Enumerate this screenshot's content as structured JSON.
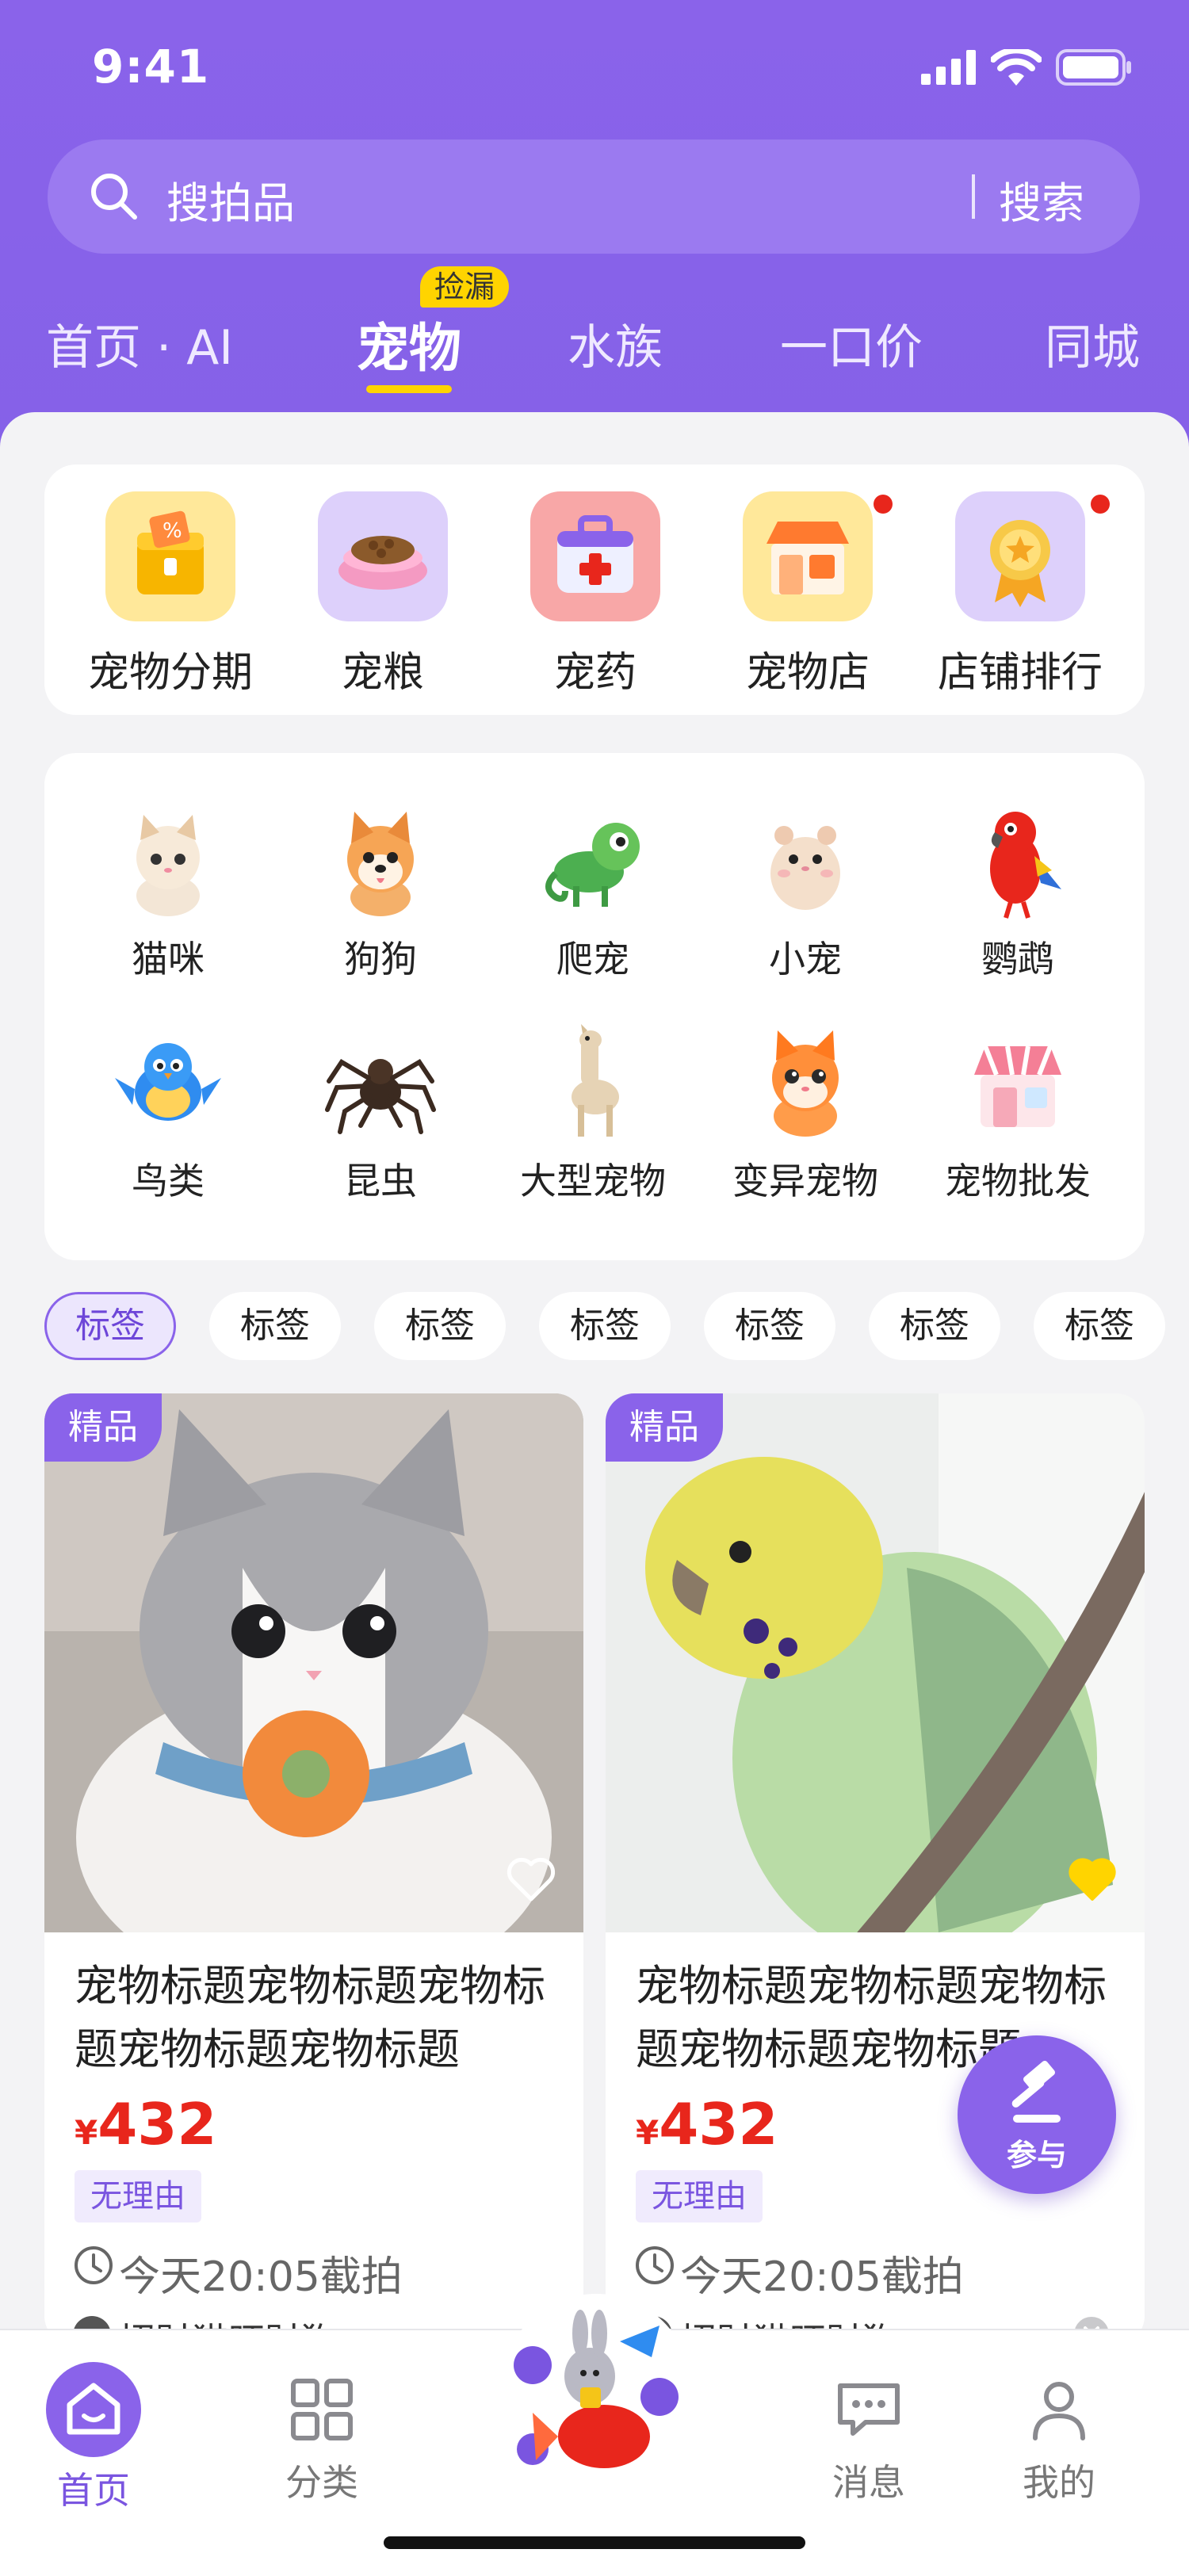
{
  "status": {
    "time": "9:41"
  },
  "search": {
    "placeholder": "搜拍品",
    "button": "搜索"
  },
  "tabs": [
    {
      "label": "首页 · AI"
    },
    {
      "label": "宠物",
      "badge": "捡漏"
    },
    {
      "label": "水族"
    },
    {
      "label": "一口价"
    },
    {
      "label": "同城"
    }
  ],
  "quick_links": [
    {
      "label": "宠物分期",
      "icon": "installment-icon"
    },
    {
      "label": "宠粮",
      "icon": "pet-food-icon"
    },
    {
      "label": "宠药",
      "icon": "medicine-kit-icon"
    },
    {
      "label": "宠物店",
      "icon": "pet-shop-icon"
    },
    {
      "label": "店铺排行",
      "icon": "ranking-medal-icon"
    }
  ],
  "categories": [
    {
      "label": "猫咪"
    },
    {
      "label": "狗狗"
    },
    {
      "label": "爬宠"
    },
    {
      "label": "小宠"
    },
    {
      "label": "鹦鹉"
    },
    {
      "label": "鸟类"
    },
    {
      "label": "昆虫"
    },
    {
      "label": "大型宠物"
    },
    {
      "label": "变异宠物"
    },
    {
      "label": "宠物批发"
    }
  ],
  "chips": [
    "标签",
    "标签",
    "标签",
    "标签",
    "标签",
    "标签",
    "标签"
  ],
  "products": [
    {
      "tag": "精品",
      "title": "宠物标题宠物标题宠物标题宠物标题宠物标题",
      "currency": "¥",
      "price": "432",
      "badge": "无理由",
      "deadline": "今天20:05截拍",
      "seller": "招财猫旺财狗",
      "liked": false
    },
    {
      "tag": "精品",
      "title": "宠物标题宠物标题宠物标题宠物标题宠物标题",
      "currency": "¥",
      "price": "432",
      "badge": "无理由",
      "deadline": "今天20:05截拍",
      "seller": "招财猫旺财狗",
      "liked": true
    }
  ],
  "float_button": {
    "label": "参与"
  },
  "bottom_nav": [
    {
      "label": "首页"
    },
    {
      "label": "分类"
    },
    {
      "label": "消息"
    },
    {
      "label": "我的"
    }
  ],
  "colors": {
    "brand": "#8a63ea",
    "price": "#e8261c",
    "highlight": "#ffd400"
  }
}
